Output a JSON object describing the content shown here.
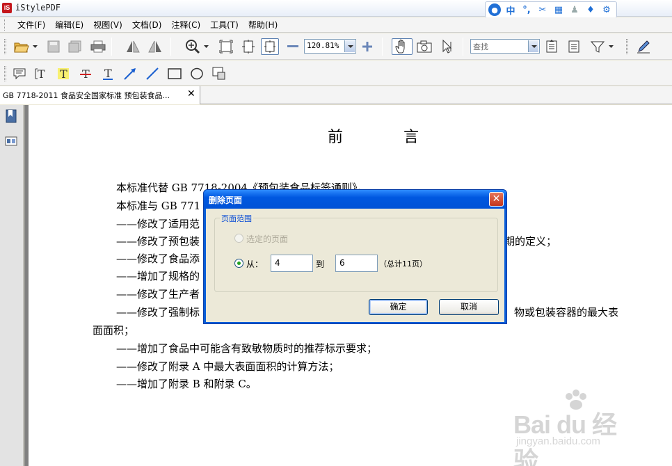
{
  "app": {
    "title": "iStylePDF"
  },
  "menu": {
    "items": [
      "文件(F)",
      "编辑(E)",
      "视图(V)",
      "文档(D)",
      "注释(C)",
      "工具(T)",
      "帮助(H)"
    ]
  },
  "toolbar": {
    "zoom_value": "120.81%",
    "search_placeholder": "查找"
  },
  "tab": {
    "label": "GB 7718-2011 食品安全国家标准 预包装食品...",
    "close": "✕"
  },
  "document": {
    "heading": "前 言",
    "lines": [
      "本标准代替 GB 7718-2004《预包装食品标签通则》。",
      "本标准与 GB 771",
      "——修改了适用范",
      "——修改了预包装",
      "期的定义；",
      "——修改了食品添",
      "——增加了规格的",
      "——修改了生产者",
      "——修改了强制标",
      "物或包装容器的最大表",
      "面面积；",
      "——增加了食品中可能含有致敏物质时的推荐标示要求；",
      "——修改了附录 A 中最大表面面积的计算方法；",
      "——增加了附录 B 和附录 C。"
    ]
  },
  "dialog": {
    "title": "删除页面",
    "group_label": "页面范围",
    "option_selected_pages": "选定的页面",
    "option_from": "从：",
    "from_value": "4",
    "to_label": "到",
    "to_value": "6",
    "total_pages": "（总计11页）",
    "ok_label": "确定",
    "cancel_label": "取消"
  },
  "ime": {
    "lang": "中",
    "punct": "°,"
  },
  "watermark": {
    "logo": "Bai du 经验",
    "url": "jingyan.baidu.com"
  },
  "colors": {
    "dialog_title_blue": "#0058e0",
    "close_red": "#c4361c",
    "radio_green": "#21a121"
  }
}
